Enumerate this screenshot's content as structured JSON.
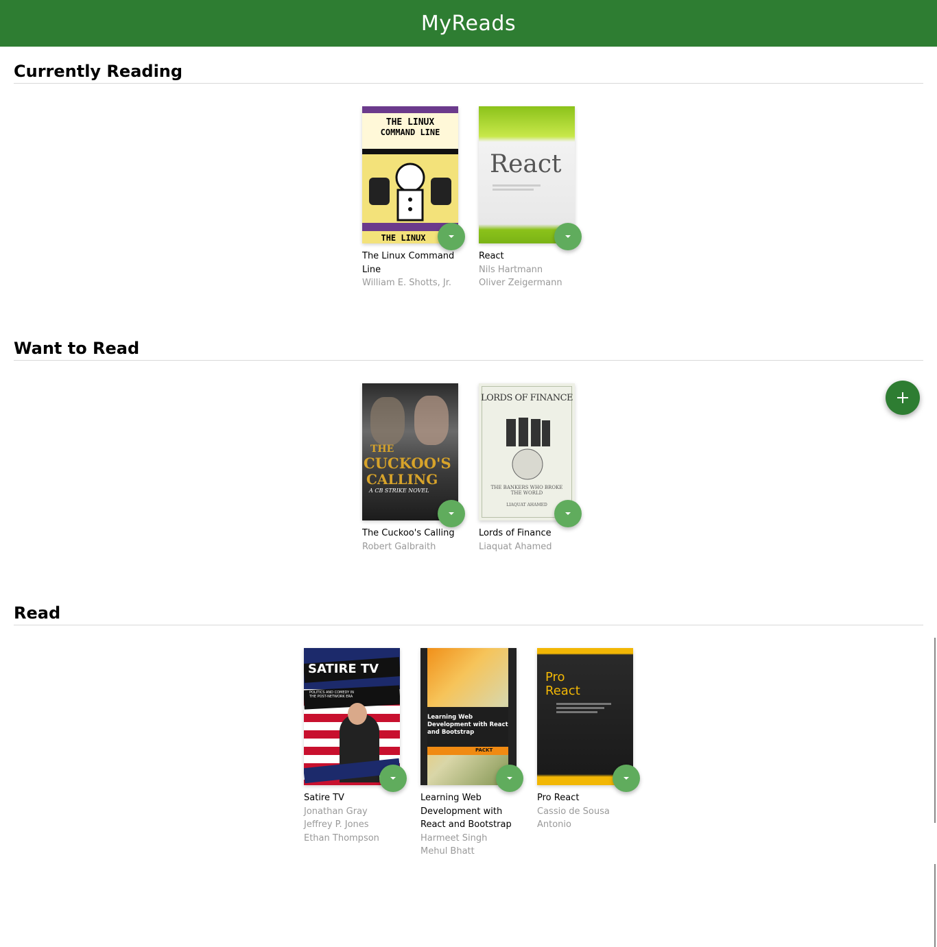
{
  "app": {
    "title": "MyReads"
  },
  "colors": {
    "header": "#2e7d32",
    "changer": "#60ac5d",
    "add": "#2e7d32"
  },
  "icons": {
    "changer": "chevron-down-icon",
    "add": "plus-icon"
  },
  "shelves": [
    {
      "title": "Currently Reading",
      "books": [
        {
          "title": "The Linux Command Line",
          "authors": [
            "William E. Shotts, Jr."
          ],
          "cover": {
            "line1": "THE LINUX",
            "line2": "COMMAND LINE",
            "bottom": "THE LINUX"
          }
        },
        {
          "title": "React",
          "authors": [
            "Nils Hartmann",
            "Oliver Zeigermann"
          ],
          "cover": {
            "line1": "React"
          }
        }
      ]
    },
    {
      "title": "Want to Read",
      "books": [
        {
          "title": "The Cuckoo's Calling",
          "authors": [
            "Robert Galbraith"
          ],
          "cover": {
            "line1": "THE",
            "line2": "CUCKOO'S",
            "line3": "CALLING",
            "sub": "A CB STRIKE NOVEL"
          }
        },
        {
          "title": "Lords of Finance",
          "authors": [
            "Liaquat Ahamed"
          ],
          "cover": {
            "line1": "LORDS OF FINANCE",
            "sub": "THE BANKERS WHO BROKE THE WORLD",
            "author": "LIAQUAT AHAMED"
          }
        }
      ]
    },
    {
      "title": "Read",
      "books": [
        {
          "title": "Satire TV",
          "authors": [
            "Jonathan Gray",
            "Jeffrey P. Jones",
            "Ethan Thompson"
          ],
          "cover": {
            "line1": "SATIRE TV",
            "sub": "POLITICS AND COMEDY IN THE POST-NETWORK ERA"
          }
        },
        {
          "title": "Learning Web Development with React and Bootstrap",
          "authors": [
            "Harmeet Singh",
            "Mehul Bhatt"
          ],
          "cover": {
            "line1": "Learning Web Development with React and Bootstrap",
            "brand": "PACKT"
          }
        },
        {
          "title": "Pro React",
          "authors": [
            "Cassio de Sousa Antonio"
          ],
          "cover": {
            "line1": "Pro",
            "line2": "React"
          }
        }
      ]
    }
  ]
}
